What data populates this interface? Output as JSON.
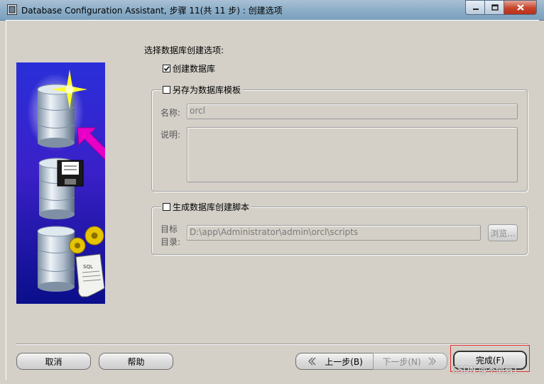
{
  "window": {
    "title": "Database Configuration Assistant, 步骤 11(共 11 步) : 创建选项"
  },
  "main": {
    "heading": "选择数据库创建选项:",
    "create_db": {
      "label": "创建数据库",
      "checked": true
    },
    "template_group": {
      "label": "另存为数据库模板",
      "checked": false,
      "name_label": "名称:",
      "name_value": "orcl",
      "desc_label": "说明:",
      "desc_value": ""
    },
    "script_group": {
      "label": "生成数据库创建脚本",
      "checked": false,
      "dir_label_line1": "目标",
      "dir_label_line2": "目录:",
      "dir_value": "D:\\app\\Administrator\\admin\\orcl\\scripts",
      "browse_label": "浏览..."
    }
  },
  "footer": {
    "cancel_label": "取消",
    "help_label": "帮助",
    "back_label": "上一步(B)",
    "next_label": "下一步(N)",
    "finish_label": "完成(F)",
    "watermark": "CSDN @不倒翁1"
  },
  "colors": {
    "panel_bg": "#d4d0c8",
    "art_bg_top": "#2a2fd8",
    "art_bg_bottom": "#0a0f8a",
    "arrow": "#e800c8",
    "highlight_box": "#e0302a"
  },
  "icons": {
    "app": "database-window-icon",
    "minimize": "minimize-icon",
    "maximize": "maximize-icon",
    "close": "close-icon",
    "back": "chevron-left-icon",
    "next": "chevron-right-icon"
  }
}
